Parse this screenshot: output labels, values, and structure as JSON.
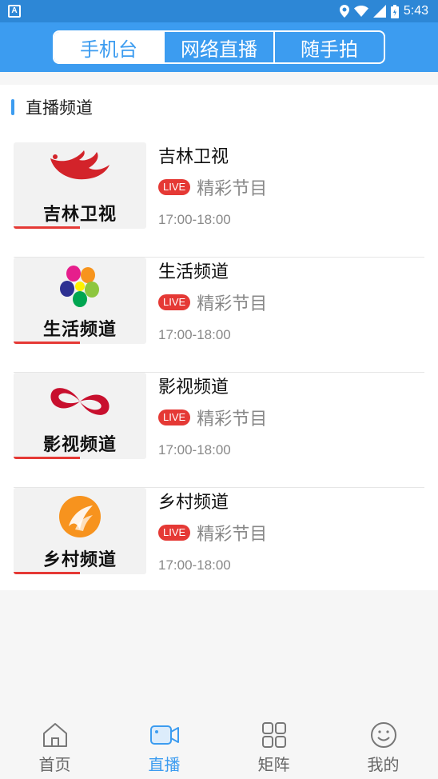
{
  "status_bar": {
    "left_icon": "A",
    "time": "5:43"
  },
  "tabs": [
    {
      "label": "手机台",
      "active": true
    },
    {
      "label": "网络直播",
      "active": false
    },
    {
      "label": "随手拍",
      "active": false
    }
  ],
  "section": {
    "title": "直播频道"
  },
  "channels": [
    {
      "title": "吉林卫视",
      "logo_text": "吉林卫视",
      "badge": "LIVE",
      "program": "精彩节目",
      "time": "17:00-18:00",
      "progress": 0.5
    },
    {
      "title": "生活频道",
      "logo_text": "生活频道",
      "badge": "LIVE",
      "program": "精彩节目",
      "time": "17:00-18:00",
      "progress": 0.5
    },
    {
      "title": "影视频道",
      "logo_text": "影视频道",
      "badge": "LIVE",
      "program": "精彩节目",
      "time": "17:00-18:00",
      "progress": 0.5
    },
    {
      "title": "乡村频道",
      "logo_text": "乡村频道",
      "badge": "LIVE",
      "program": "精彩节目",
      "time": "17:00-18:00",
      "progress": 0.5
    }
  ],
  "bottom_nav": [
    {
      "label": "首页",
      "icon": "home-icon",
      "active": false
    },
    {
      "label": "直播",
      "icon": "video-camera-icon",
      "active": true
    },
    {
      "label": "矩阵",
      "icon": "grid-icon",
      "active": false
    },
    {
      "label": "我的",
      "icon": "smiley-icon",
      "active": false
    }
  ],
  "colors": {
    "primary": "#3c9cf0",
    "live_red": "#e53935"
  }
}
